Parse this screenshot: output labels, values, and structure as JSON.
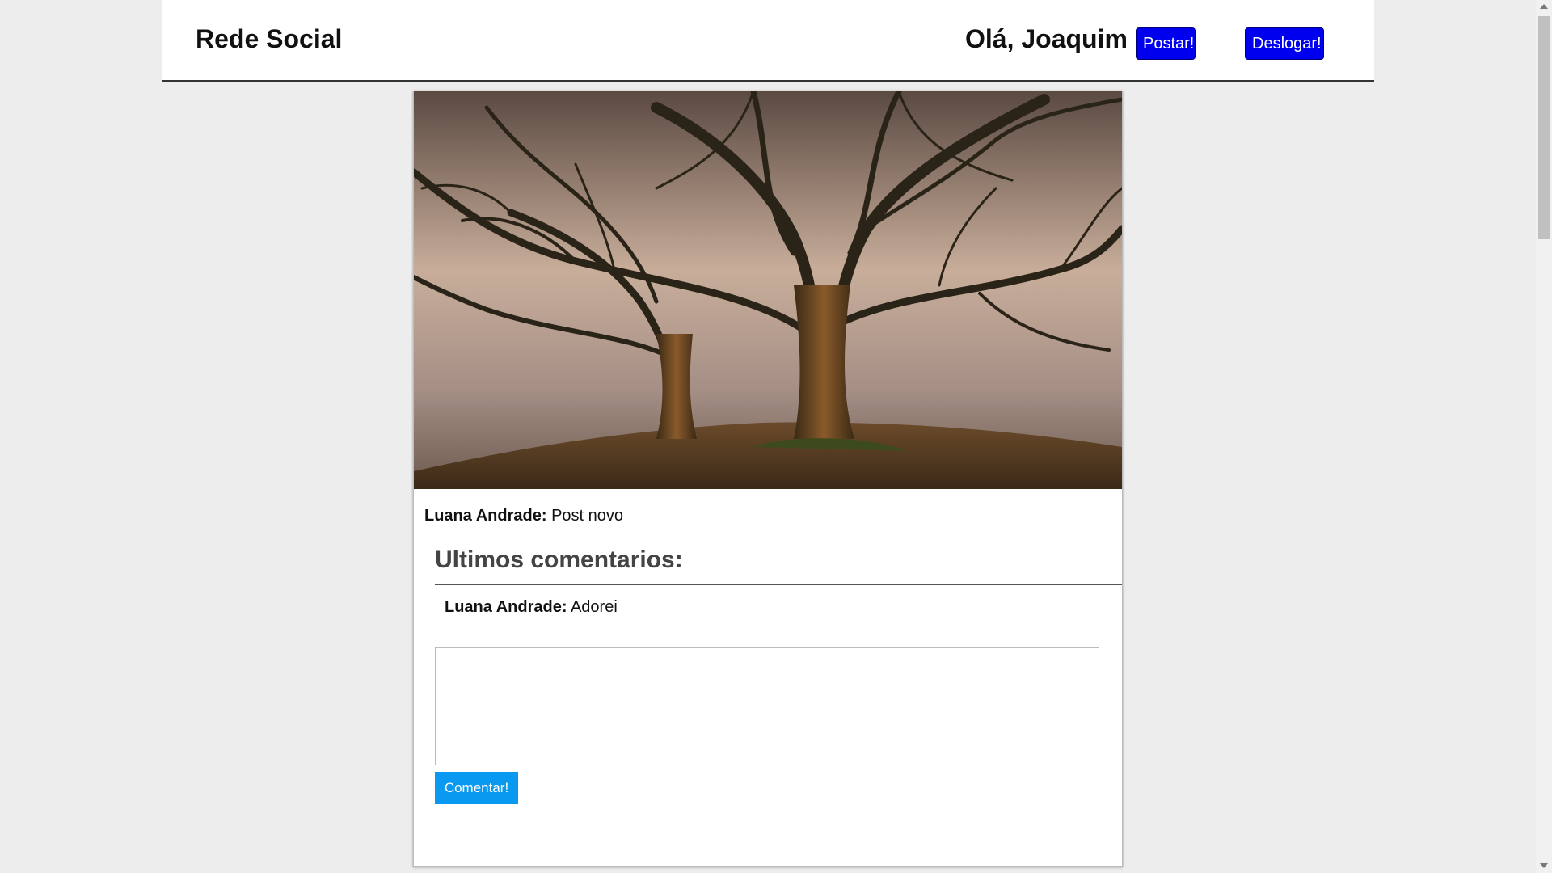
{
  "header": {
    "brand": "Rede Social",
    "greeting": "Olá, Joaquim",
    "post_button": "Postar!",
    "logout_button": "Deslogar!"
  },
  "post": {
    "author": "Luana Andrade:",
    "text": "Post novo",
    "image_icon": "tree-photo"
  },
  "comments": {
    "title": "Ultimos comentarios:",
    "items": [
      {
        "author": "Luana Andrade:",
        "text": "Adorei"
      }
    ],
    "input_value": "",
    "submit_button": "Comentar!"
  },
  "colors": {
    "primary_button": "#0000ee",
    "comment_button": "#0a99f0",
    "page_background": "#ededed"
  }
}
